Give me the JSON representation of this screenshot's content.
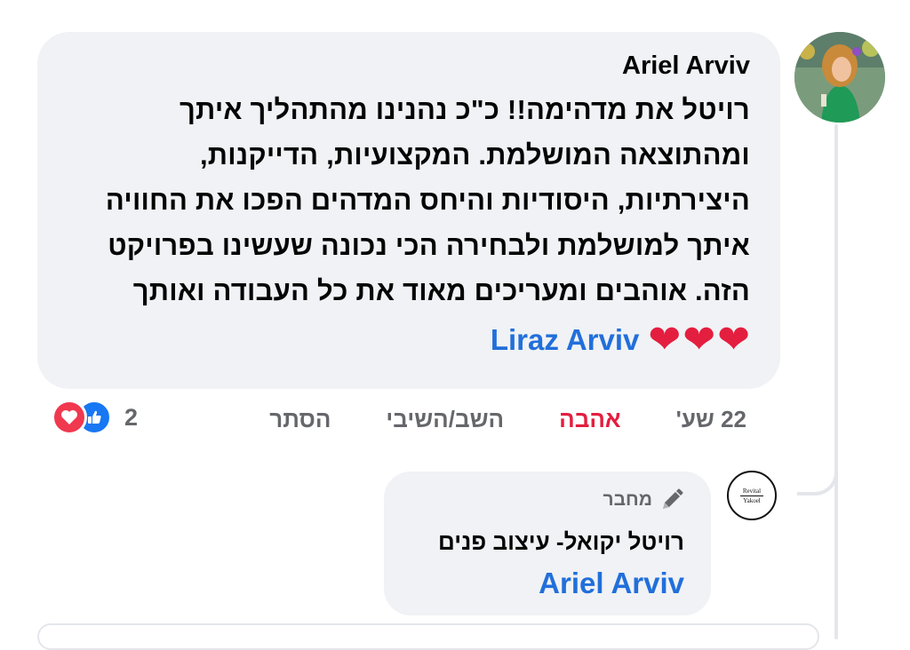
{
  "comment": {
    "author": "Ariel Arviv",
    "lines": [
      "רויטל את מדהימה!! כ\"כ נהנינו מהתהליך איתך",
      "ומהתוצאה המושלמת. המקצועיות, הדייקנות,",
      "היצירתיות, היסודיות והיחס המדהים הפכו את החוויה",
      "איתך למושלמת ולבחירה הכי נכונה שעשינו בפרויקט",
      "הזה. אוהבים ומעריכים מאוד את כל העבודה ואותך"
    ],
    "hearts": [
      "❤",
      "❤",
      "❤"
    ],
    "mention": "Liraz Arviv",
    "timestamp": "22 שע'",
    "like_action": "אהבה",
    "reply_action": "השב/השיבי",
    "hide_action": "הסתר",
    "reaction_count": "2",
    "reaction_icons": [
      "love-icon",
      "like-icon"
    ],
    "colors": {
      "love": "#f0384f",
      "like": "#1877f2",
      "mention": "#216fdb",
      "bubble": "#f0f2f5"
    }
  },
  "reply": {
    "badge": "מחבר",
    "author": "רויטל יקואל- עיצוב פנים",
    "mention": "Ariel Arviv",
    "avatar_logo_top": "Revital",
    "avatar_logo_bottom": "Yakoel"
  }
}
